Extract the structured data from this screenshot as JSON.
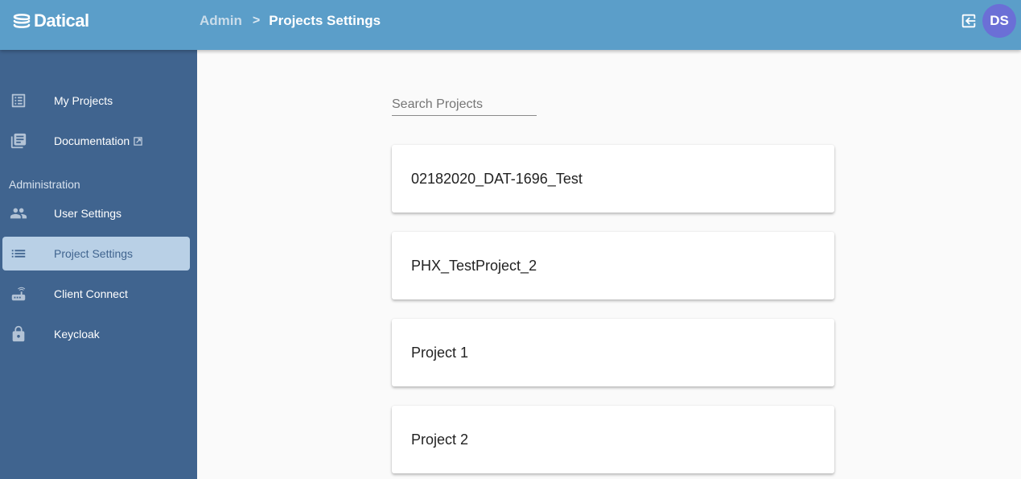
{
  "header": {
    "logo_text": "Datical",
    "breadcrumb": {
      "parent": "Admin",
      "separator": ">",
      "current": "Projects Settings"
    },
    "avatar_initials": "DS",
    "colors": {
      "header_bg": "#5b9ec9",
      "avatar_bg": "#6b6fd6"
    }
  },
  "sidebar": {
    "items": [
      {
        "label": "My Projects",
        "icon": "list-alt-icon"
      },
      {
        "label": "Documentation",
        "icon": "library-books-icon",
        "external": true
      }
    ],
    "section_title": "Administration",
    "admin_items": [
      {
        "label": "User Settings",
        "icon": "people-icon"
      },
      {
        "label": "Project Settings",
        "icon": "list-icon",
        "active": true
      },
      {
        "label": "Client Connect",
        "icon": "router-icon"
      },
      {
        "label": "Keycloak",
        "icon": "lock-icon"
      }
    ],
    "colors": {
      "bg": "#40648f",
      "active_bg": "#b9d0e6"
    }
  },
  "main": {
    "search": {
      "placeholder": "Search Projects",
      "value": ""
    },
    "projects": [
      {
        "name": "02182020_DAT-1696_Test"
      },
      {
        "name": "PHX_TestProject_2"
      },
      {
        "name": "Project 1"
      },
      {
        "name": "Project 2"
      }
    ]
  }
}
